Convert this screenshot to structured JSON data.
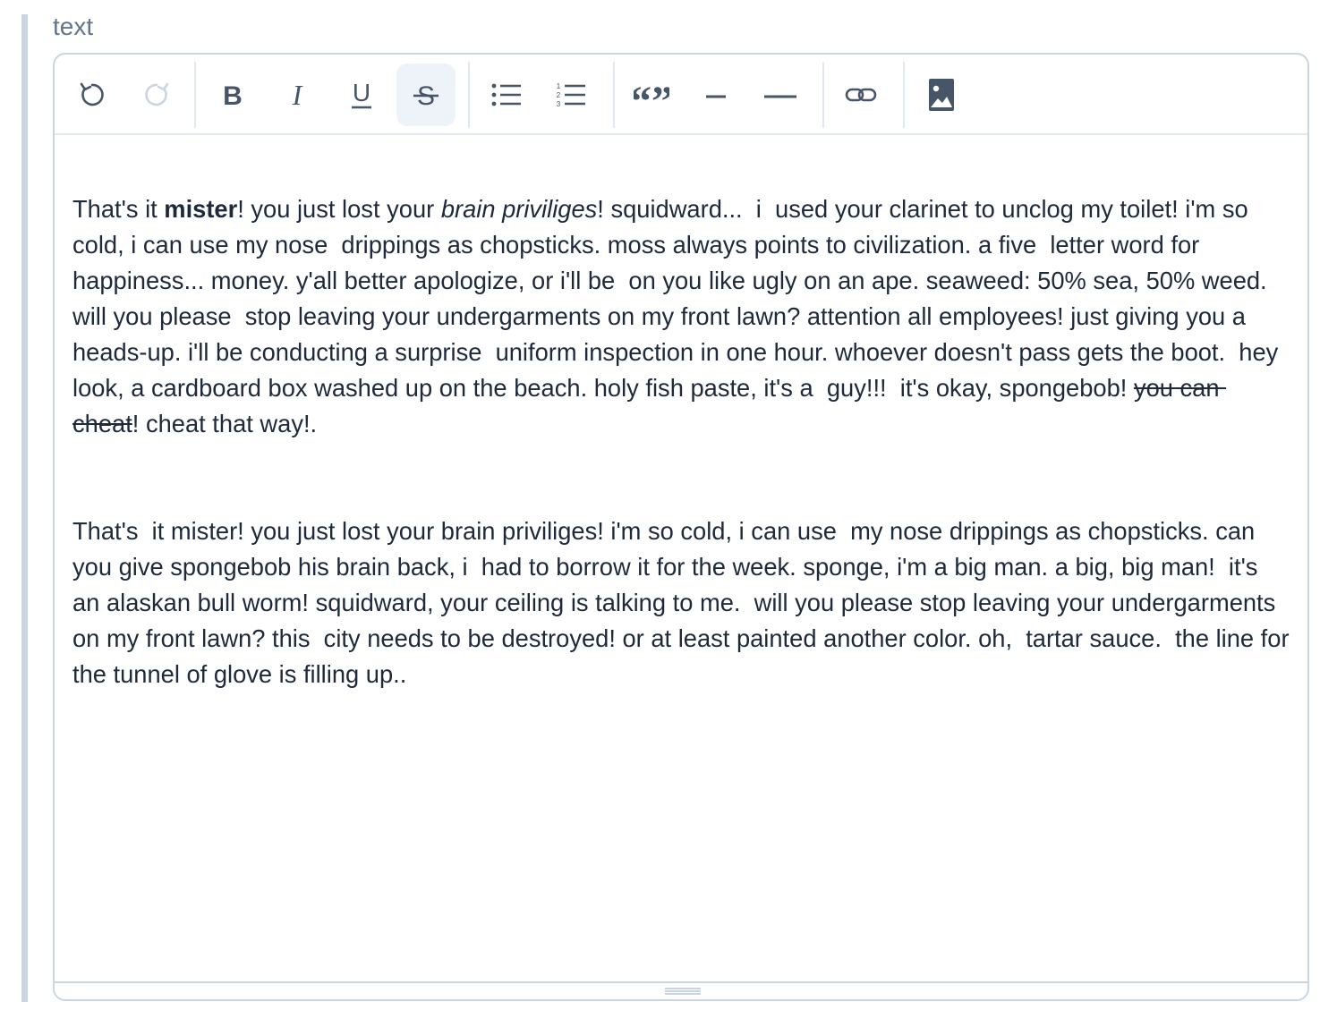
{
  "field": {
    "label": "text"
  },
  "toolbar": {
    "buttons": [
      {
        "name": "undo",
        "icon": "undo-icon"
      },
      {
        "name": "redo",
        "icon": "redo-icon"
      },
      {
        "name": "bold",
        "icon": "bold-icon"
      },
      {
        "name": "italic",
        "icon": "italic-icon"
      },
      {
        "name": "underline",
        "icon": "underline-icon"
      },
      {
        "name": "strikethrough",
        "icon": "strikethrough-icon",
        "active": true
      },
      {
        "name": "bullet-list",
        "icon": "bullet-list-icon"
      },
      {
        "name": "ordered-list",
        "icon": "ordered-list-icon"
      },
      {
        "name": "blockquote",
        "icon": "quote-icon"
      },
      {
        "name": "dash",
        "icon": "short-dash-icon"
      },
      {
        "name": "horizontal-rule",
        "icon": "horizontal-rule-icon"
      },
      {
        "name": "link",
        "icon": "link-icon"
      },
      {
        "name": "image",
        "icon": "image-icon"
      }
    ]
  },
  "content": {
    "p1": {
      "s1": "That's it ",
      "s2": "mister",
      "s3": "! you just lost your ",
      "s4": "brain priviliges",
      "s5": "! squidward...  i  used your clarinet to unclog my toilet! i'm so cold, i can use my nose  drippings as chopsticks. moss always points to civilization. a five  letter word for happiness... money. y'all better apologize, or i'll be  on you like ugly on an ape. seaweed: 50% sea, 50% weed. will you please  stop leaving your undergarments on my front lawn? attention all employees! just giving you a heads-up. i'll be conducting a surprise  uniform inspection in one hour. whoever doesn't pass gets the boot.  hey  look, a cardboard box washed up on the beach. holy fish paste, it's a  guy!!!  it's okay, spongebob! ",
      "s6": "you can cheat",
      "s7": "! cheat that way!."
    },
    "p2": "That's  it mister! you just lost your brain priviliges! i'm so cold, i can use  my nose drippings as chopsticks. can you give spongebob his brain back, i  had to borrow it for the week. sponge, i'm a big man. a big, big man!  it's an alaskan bull worm! squidward, your ceiling is talking to me.  will you please stop leaving your undergarments on my front lawn? this  city needs to be destroyed! or at least painted another color. oh,  tartar sauce.  the line for the tunnel of glove is filling up.."
  },
  "colors": {
    "text": "#1e293b",
    "label": "#64748b",
    "border": "#cbd5e1",
    "active_bg": "#eef2f9",
    "icon": "#475569",
    "icon_disabled": "#cbd5e1"
  }
}
